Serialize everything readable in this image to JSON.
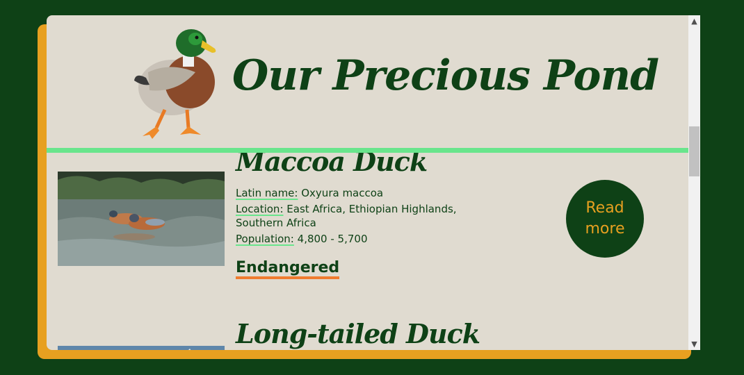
{
  "header": {
    "title": "Our Precious Pond",
    "logo_icon": "mallard-duck-icon"
  },
  "ducks": [
    {
      "name": "Maccoa Duck",
      "latin_label": "Latin name:",
      "latin_value": "Oxyura maccoa",
      "location_label": "Location:",
      "location_value": "East Africa, Ethiopian Highlands, Southern Africa",
      "population_label": "Population:",
      "population_value": "4,800 - 5,700",
      "status": "Endangered",
      "button": "Read more"
    },
    {
      "name": "Long-tailed Duck"
    }
  ],
  "colors": {
    "background": "#0e4116",
    "panel": "#e0dbd0",
    "accent_orange": "#e7a020",
    "rule_green": "#69e58c",
    "status_underline": "#ef7b2f"
  },
  "scrollbar": {
    "up_icon": "scroll-up-arrow-icon",
    "down_icon": "scroll-down-arrow-icon"
  }
}
